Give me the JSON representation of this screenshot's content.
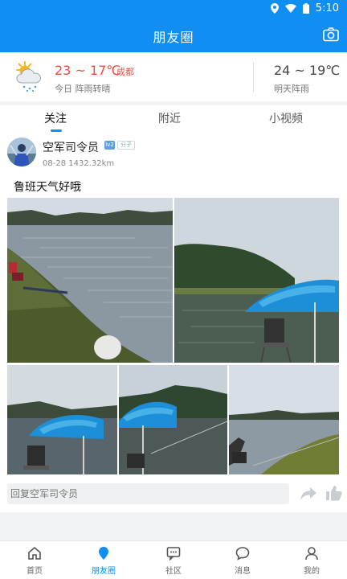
{
  "status": {
    "time": "5:10"
  },
  "header": {
    "title": "朋友圈"
  },
  "weather": {
    "today_temp": "23 ~ 17℃",
    "city": "成都",
    "today_desc": "今日 阵雨转晴",
    "tomorrow_temp": "24 ~ 19℃",
    "tomorrow_desc": "明天阵雨"
  },
  "tabs": [
    {
      "label": "关注"
    },
    {
      "label": "附近"
    },
    {
      "label": "小视频"
    }
  ],
  "post": {
    "username": "空军司令员",
    "badge": "lv2",
    "badge2": "分子",
    "meta": "08-28 1432.32km",
    "text": "鲁班天气好哦",
    "reply_placeholder": "回复空军司令员"
  },
  "nav": [
    {
      "label": "首页"
    },
    {
      "label": "朋友圈"
    },
    {
      "label": "社区"
    },
    {
      "label": "消息"
    },
    {
      "label": "我的"
    }
  ],
  "colors": {
    "accent": "#0f8ff2",
    "temp_red": "#ef4a3e"
  }
}
